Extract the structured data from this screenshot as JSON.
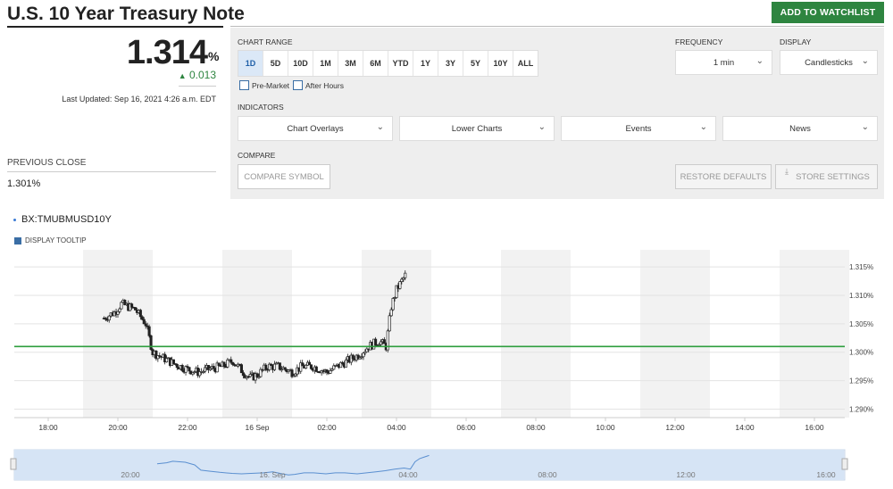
{
  "header": {
    "title": "U.S. 10 Year Treasury Note",
    "watchlist_button": "ADD TO WATCHLIST"
  },
  "quote": {
    "price": "1.314",
    "unit": "%",
    "change": "0.013",
    "change_direction": "up",
    "last_updated": "Last Updated: Sep 16, 2021 4:26 a.m. EDT",
    "previous_close_label": "PREVIOUS CLOSE",
    "previous_close_value": "1.301%"
  },
  "controls": {
    "chart_range_label": "CHART RANGE",
    "ranges": [
      "1D",
      "5D",
      "10D",
      "1M",
      "3M",
      "6M",
      "YTD",
      "1Y",
      "3Y",
      "5Y",
      "10Y",
      "ALL"
    ],
    "active_range": "1D",
    "pre_market_label": "Pre-Market",
    "after_hours_label": "After Hours",
    "frequency_label": "FREQUENCY",
    "frequency_value": "1 min",
    "display_label": "DISPLAY",
    "display_value": "Candlesticks",
    "indicators_label": "INDICATORS",
    "indicator_menus": [
      "Chart Overlays",
      "Lower Charts",
      "Events",
      "News"
    ],
    "compare_label": "COMPARE",
    "compare_placeholder": "COMPARE SYMBOL",
    "restore_defaults_label": "RESTORE DEFAULTS",
    "store_settings_label": "STORE SETTINGS"
  },
  "chart": {
    "symbol": "BX:TMUBMUSD10Y",
    "tooltip_label": "DISPLAY TOOLTIP",
    "colors": {
      "candle": "#222222",
      "previous_close_line": "#2e9e3e",
      "navigator_fill": "#d6e4f5",
      "navigator_line": "#5a8fd0"
    }
  },
  "chart_data": {
    "type": "candlestick",
    "title": "",
    "x_tick_labels": [
      "18:00",
      "20:00",
      "22:00",
      "16 Sep",
      "02:00",
      "04:00",
      "06:00",
      "08:00",
      "10:00",
      "12:00",
      "14:00",
      "16:00"
    ],
    "y_tick_labels": [
      "1.315%",
      "1.310%",
      "1.305%",
      "1.300%",
      "1.295%",
      "1.290%"
    ],
    "ylim": [
      1.2885,
      1.318
    ],
    "previous_close": 1.301,
    "grid": true,
    "series": [
      {
        "x_hours_start": 19.6,
        "x_hours_end": 4.3,
        "close_path": [
          [
            19.6,
            1.306
          ],
          [
            19.9,
            1.307
          ],
          [
            20.1,
            1.3085
          ],
          [
            20.5,
            1.3075
          ],
          [
            20.8,
            1.305
          ],
          [
            21.0,
            1.3
          ],
          [
            21.3,
            1.299
          ],
          [
            21.6,
            1.298
          ],
          [
            22.0,
            1.297
          ],
          [
            22.3,
            1.2965
          ],
          [
            22.6,
            1.297
          ],
          [
            23.0,
            1.2975
          ],
          [
            23.3,
            1.2985
          ],
          [
            23.6,
            1.2965
          ],
          [
            23.8,
            1.2955
          ],
          [
            0.0,
            1.296
          ],
          [
            0.3,
            1.2975
          ],
          [
            0.6,
            1.2975
          ],
          [
            1.0,
            1.2965
          ],
          [
            1.3,
            1.2975
          ],
          [
            1.6,
            1.2975
          ],
          [
            2.0,
            1.2965
          ],
          [
            2.3,
            1.2975
          ],
          [
            2.6,
            1.2985
          ],
          [
            2.9,
            1.2995
          ],
          [
            3.2,
            1.301
          ],
          [
            3.5,
            1.302
          ],
          [
            3.7,
            1.301
          ],
          [
            3.85,
            1.308
          ],
          [
            4.0,
            1.311
          ],
          [
            4.15,
            1.3125
          ],
          [
            4.3,
            1.314
          ]
        ]
      }
    ],
    "navigator_labels": [
      "20:00",
      "16. Sep",
      "04:00",
      "08:00",
      "12:00",
      "16:00"
    ]
  }
}
